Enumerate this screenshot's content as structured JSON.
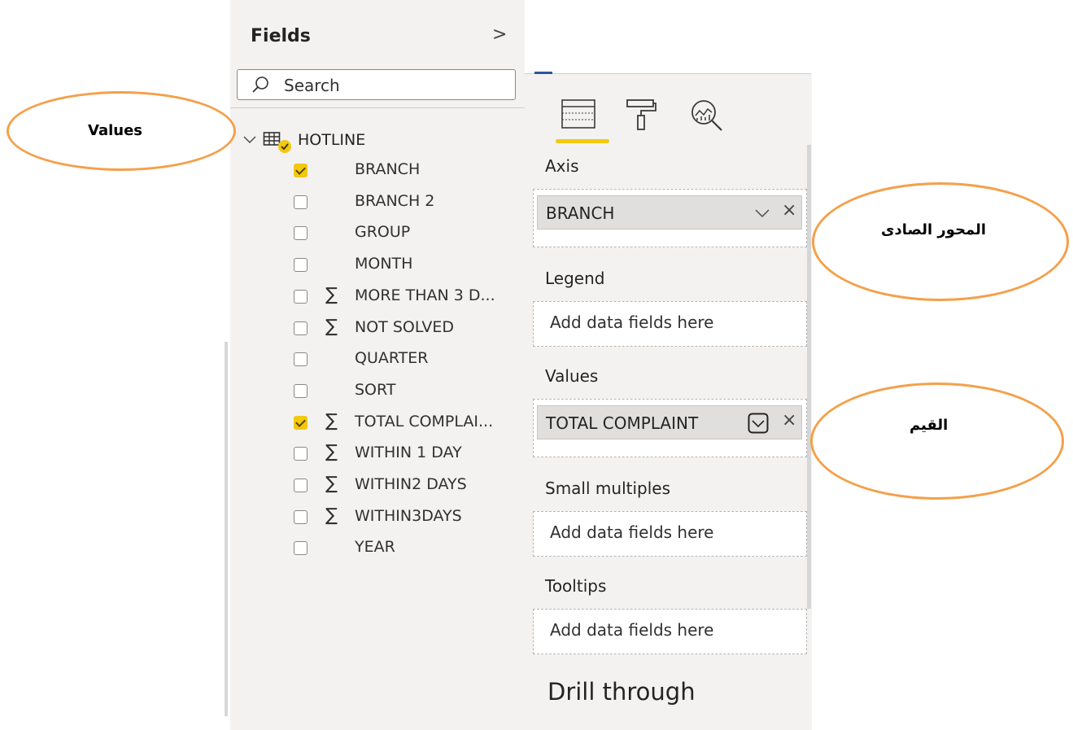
{
  "fields_pane": {
    "title": "Fields",
    "search_placeholder": "Search",
    "table": {
      "name": "HOTLINE",
      "expanded": true
    },
    "fields": [
      {
        "label": "BRANCH",
        "checked": true,
        "sigma": false
      },
      {
        "label": "BRANCH 2",
        "checked": false,
        "sigma": false
      },
      {
        "label": "GROUP",
        "checked": false,
        "sigma": false
      },
      {
        "label": "MONTH",
        "checked": false,
        "sigma": false
      },
      {
        "label": "MORE THAN 3 D...",
        "checked": false,
        "sigma": true
      },
      {
        "label": "NOT SOLVED",
        "checked": false,
        "sigma": true
      },
      {
        "label": "QUARTER",
        "checked": false,
        "sigma": false
      },
      {
        "label": "SORT",
        "checked": false,
        "sigma": false
      },
      {
        "label": "TOTAL COMPLAI...",
        "checked": true,
        "sigma": true
      },
      {
        "label": "WITHIN 1 DAY",
        "checked": false,
        "sigma": true
      },
      {
        "label": "WITHIN2 DAYS",
        "checked": false,
        "sigma": true
      },
      {
        "label": "WITHIN3DAYS",
        "checked": false,
        "sigma": true
      },
      {
        "label": "YEAR",
        "checked": false,
        "sigma": false
      }
    ],
    "sigma_symbol": "∑"
  },
  "viz_pane": {
    "wells": {
      "axis": {
        "title": "Axis",
        "field": "BRANCH"
      },
      "legend": {
        "title": "Legend",
        "placeholder": "Add data fields here"
      },
      "values": {
        "title": "Values",
        "field": "TOTAL COMPLAINT"
      },
      "small_multiples": {
        "title": "Small multiples",
        "placeholder": "Add data fields here"
      },
      "tooltips": {
        "title": "Tooltips",
        "placeholder": "Add data fields here"
      }
    },
    "drill_through": "Drill through",
    "active_tab": "fields",
    "remove_symbol": "×"
  },
  "annotations": {
    "values": "Values",
    "axis_arabic": "المحور الصادى",
    "values_arabic": "القيم"
  },
  "colors": {
    "accent": "#f2c811",
    "annotation_outline": "#f4a04b",
    "pane_bg": "#f3f2f1"
  }
}
